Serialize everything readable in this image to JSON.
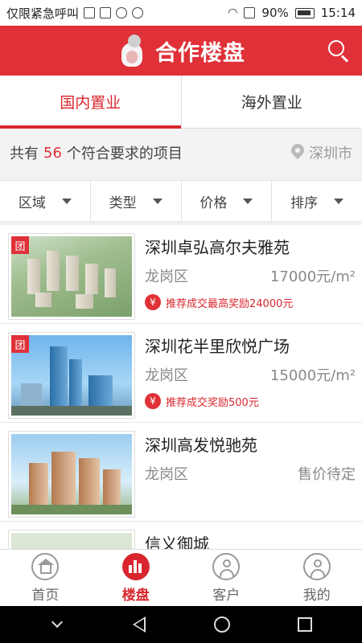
{
  "status_bar": {
    "carrier_text": "仅限紧急呼叫",
    "battery": "90%",
    "time": "15:14"
  },
  "header": {
    "title": "合作楼盘",
    "logo_icon": "mascot-logo-icon",
    "search_icon": "search-icon",
    "accent_color": "#e03038"
  },
  "tabs": [
    {
      "label": "国内置业",
      "active": true
    },
    {
      "label": "海外置业",
      "active": false
    }
  ],
  "summary": {
    "prefix": "共有",
    "count": "56",
    "suffix": "个符合要求的项目",
    "city": "深圳市"
  },
  "filters": [
    {
      "label": "区域"
    },
    {
      "label": "类型"
    },
    {
      "label": "价格"
    },
    {
      "label": "排序"
    }
  ],
  "listings": [
    {
      "title": "深圳卓弘高尔夫雅苑",
      "district": "龙岗区",
      "price": "17000元/m²",
      "badge": "团",
      "reward_icon": "¥",
      "reward": "推荐成交最高奖励24000元"
    },
    {
      "title": "深圳花半里欣悦广场",
      "district": "龙岗区",
      "price": "15000元/m²",
      "badge": "团",
      "reward_icon": "¥",
      "reward": "推荐成交奖励500元"
    },
    {
      "title": "深圳高发悦驰苑",
      "district": "龙岗区",
      "price": "售价待定"
    },
    {
      "title": "信义御城"
    }
  ],
  "bottom_nav": [
    {
      "label": "首页",
      "icon": "home-icon",
      "active": false
    },
    {
      "label": "楼盘",
      "icon": "buildings-icon",
      "active": true
    },
    {
      "label": "客户",
      "icon": "customer-icon",
      "active": false
    },
    {
      "label": "我的",
      "icon": "profile-icon",
      "active": false
    }
  ]
}
